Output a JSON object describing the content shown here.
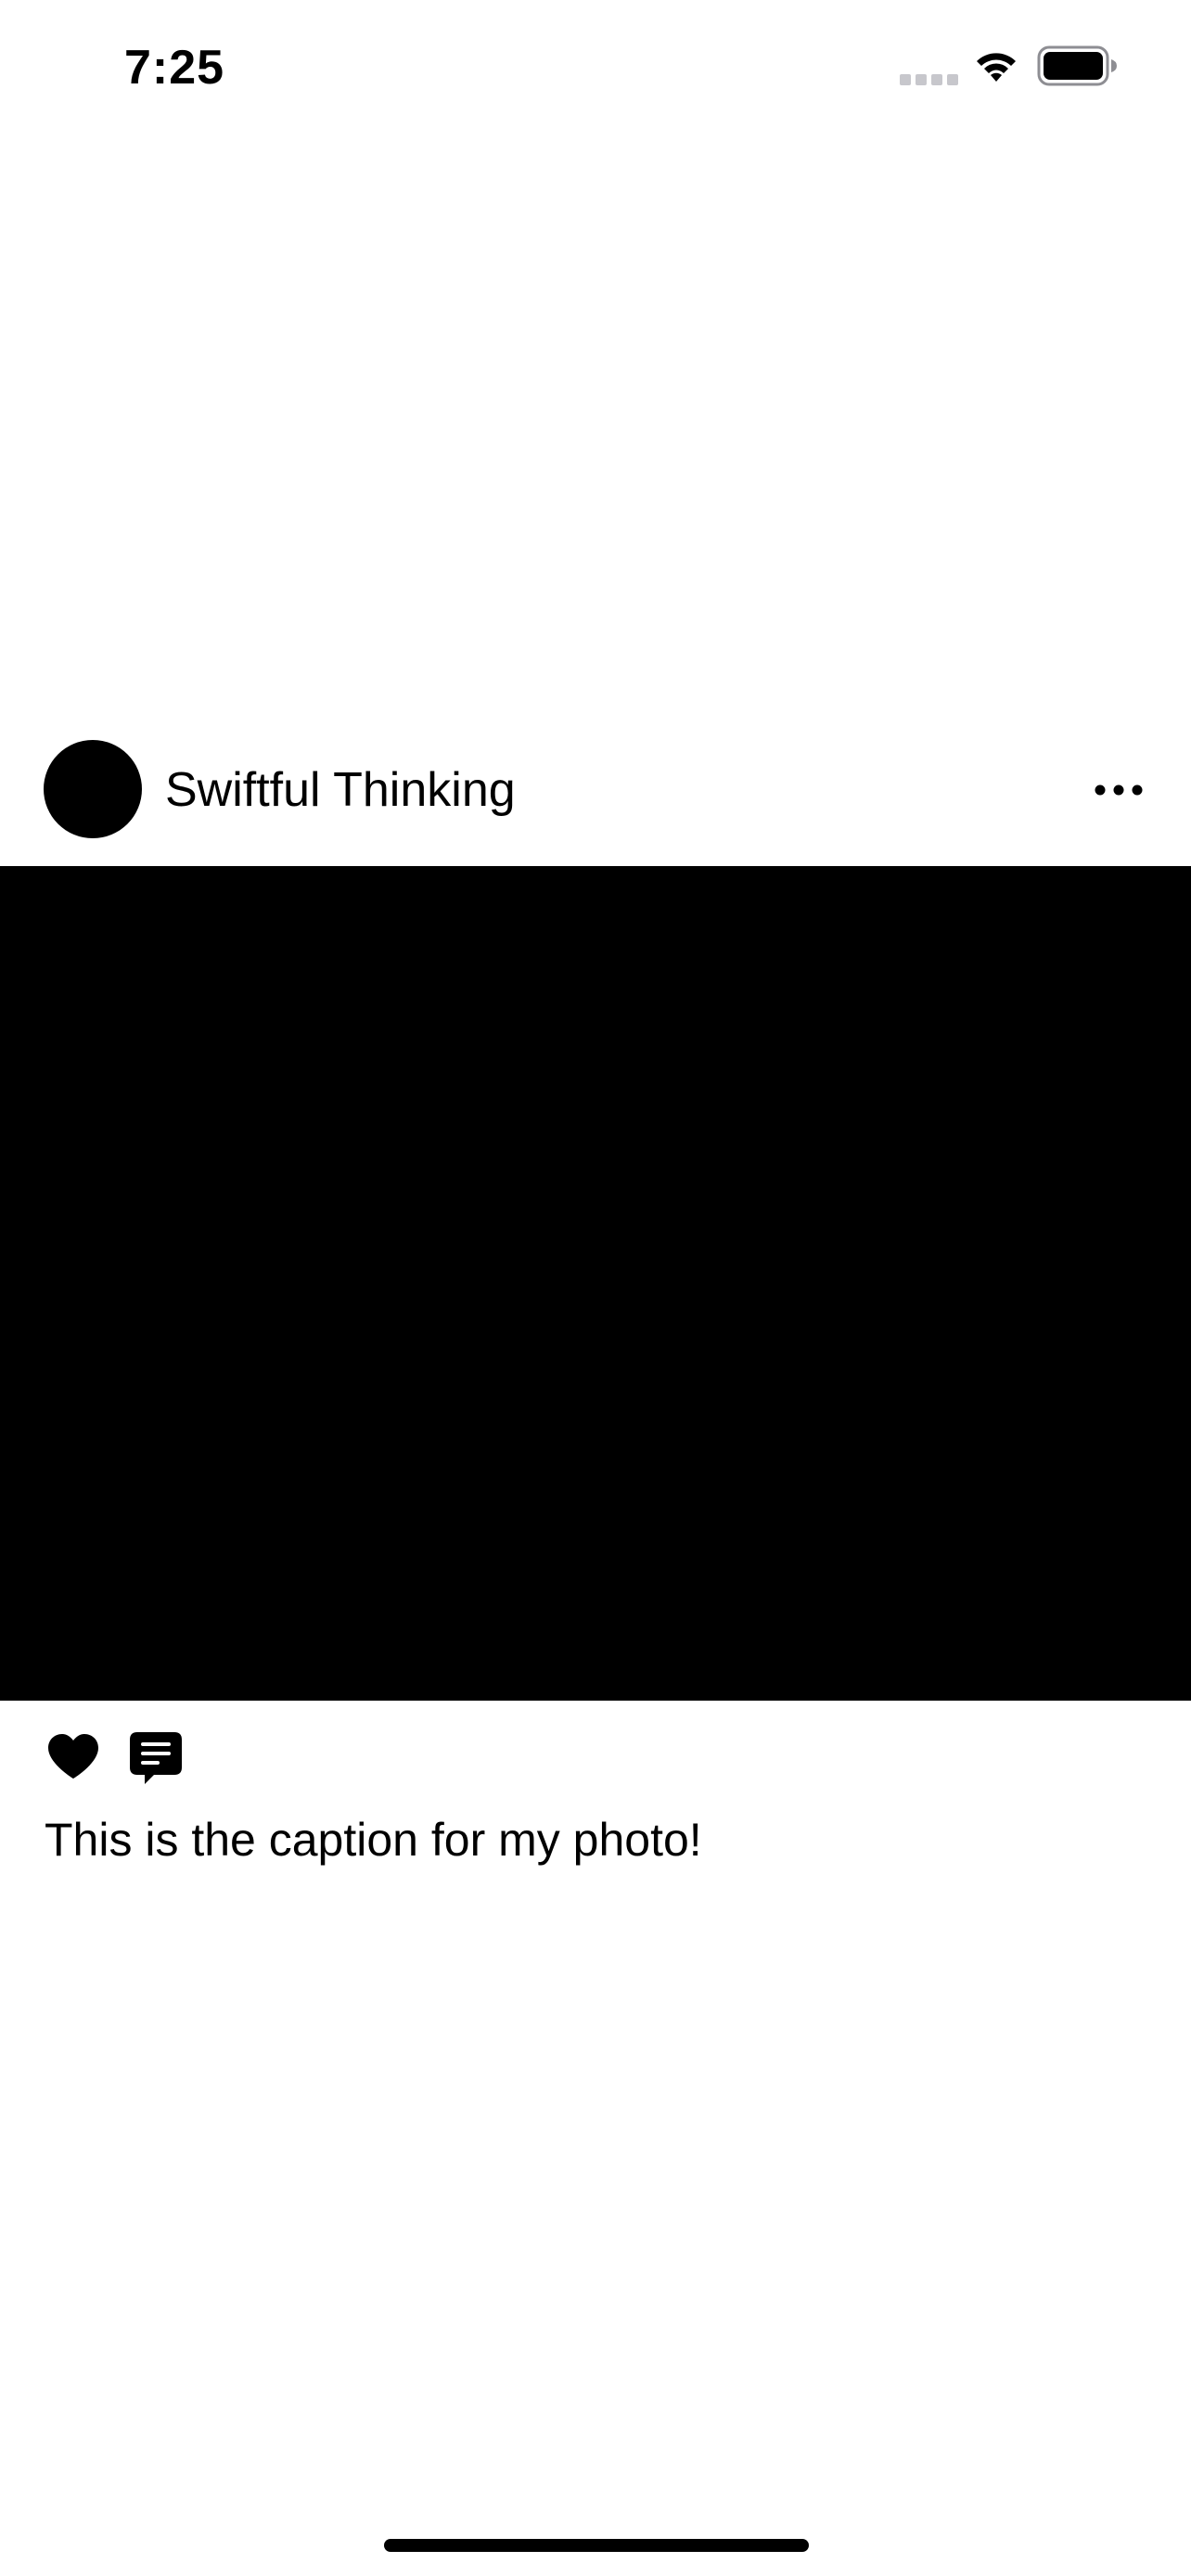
{
  "status_bar": {
    "time": "7:25",
    "icons": [
      "cellular-signal-icon",
      "wifi-icon",
      "battery-icon"
    ]
  },
  "post": {
    "username": "Swiftful Thinking",
    "more_icon": "ellipsis-icon",
    "like_icon": "heart-fill-icon",
    "comment_icon": "message-fill-icon",
    "caption": "This is the caption for my photo!",
    "image_color": "#000000"
  },
  "colors": {
    "background": "#ffffff",
    "foreground": "#000000"
  }
}
